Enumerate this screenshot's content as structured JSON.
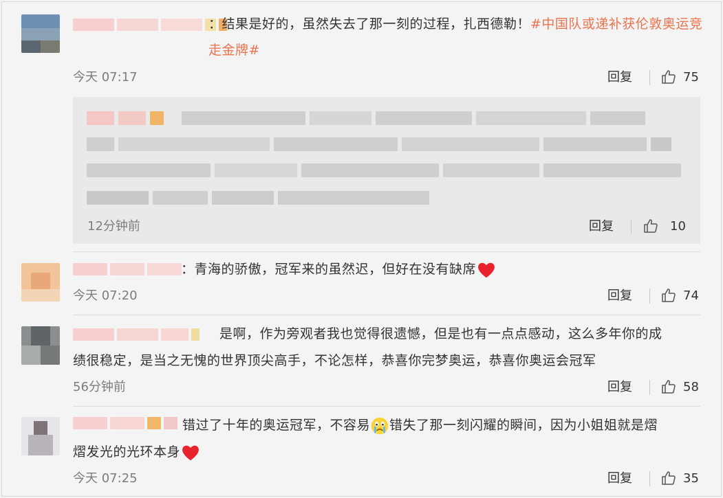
{
  "comments": [
    {
      "text": "：结果是好的，虽然失去了那一刻的过程，扎西德勒！",
      "hashtag": "#中国队或递补获伦敦奥运竞走金牌#",
      "time": "今天 07:17",
      "reply_label": "回复",
      "likes": "75"
    },
    {
      "text": "：青海的骄傲，冠军来的虽然迟，但好在没有缺席",
      "time": "今天 07:20",
      "reply_label": "回复",
      "likes": "74"
    },
    {
      "text_line1": "是啊，作为旁观者我也觉得很遗憾，但是也有一点点感动，这么多年你的成",
      "text_line2": "绩很稳定，是当之无愧的世界顶尖高手，不论怎样，恭喜你完梦奥运，恭喜你奥运会冠军",
      "time": "56分钟前",
      "reply_label": "回复",
      "likes": "58"
    },
    {
      "text_line1a": "错过了十年的奥运冠军，不容易",
      "text_line1b": "错失了那一刻闪耀的瞬间，因为小姐姐就是熠",
      "text_line2": "熠发光的光环本身",
      "time": "今天 07:25",
      "reply_label": "回复",
      "likes": "35"
    }
  ],
  "nested_reply": {
    "time": "12分钟前",
    "reply_label": "回复",
    "likes": "10"
  },
  "icons": {
    "like": "thumbs-up-icon",
    "heart": "red-heart-emoji",
    "crying": "crying-face-emoji"
  },
  "colors": {
    "hashtag": "#eb7350",
    "heart": "#e8232d"
  }
}
